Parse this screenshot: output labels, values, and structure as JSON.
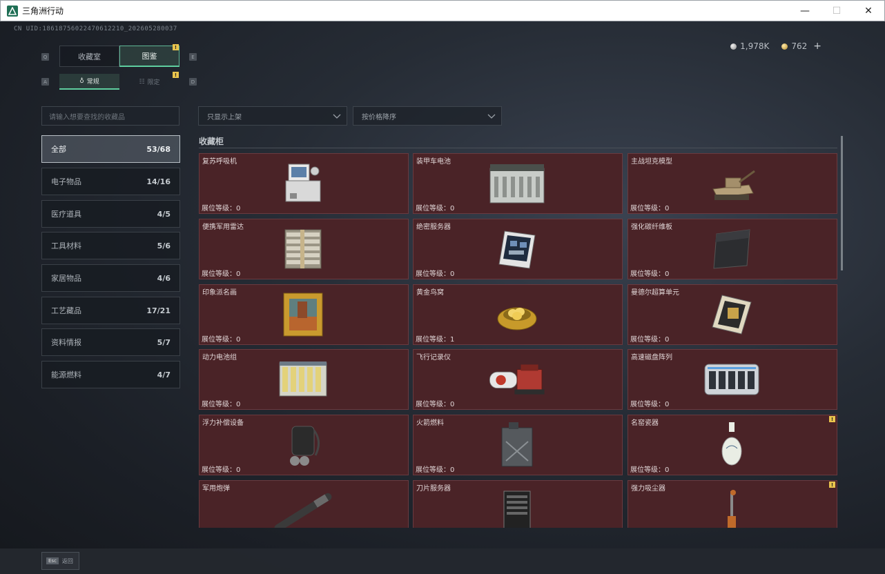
{
  "window": {
    "title": "三角洲行动",
    "minimize": "—",
    "maximize": "☐",
    "close": "✕"
  },
  "header": {
    "uid": "CN UID:18618756022470612210_202605280037"
  },
  "currency": [
    {
      "icon": "silver-coin-icon",
      "value": "1,978K"
    },
    {
      "icon": "gold-coin-icon",
      "value": "762"
    }
  ],
  "currency_add": "+",
  "keys": {
    "q": "Q",
    "e": "E",
    "a": "A",
    "d": "D"
  },
  "tabs": [
    {
      "label": "收藏室",
      "active": false
    },
    {
      "label": "图鉴",
      "active": true,
      "badge": "!"
    }
  ],
  "subtabs": [
    {
      "label": "常规",
      "active": true
    },
    {
      "label": "限定",
      "active": false,
      "badge": "!"
    }
  ],
  "search": {
    "placeholder": "请输入想要查找的收藏品"
  },
  "filters": [
    {
      "value": "只显示上架"
    },
    {
      "value": "按价格降序"
    }
  ],
  "categories": [
    {
      "label": "全部",
      "count": "53/68",
      "active": true
    },
    {
      "label": "电子物品",
      "count": "14/16"
    },
    {
      "label": "医疗道具",
      "count": "4/5"
    },
    {
      "label": "工具材料",
      "count": "5/6"
    },
    {
      "label": "家居物品",
      "count": "4/6"
    },
    {
      "label": "工艺藏品",
      "count": "17/21"
    },
    {
      "label": "资料情报",
      "count": "5/7"
    },
    {
      "label": "能源燃料",
      "count": "4/7"
    }
  ],
  "section_title": "收藏柜",
  "level_prefix": "展位等级：",
  "items": [
    {
      "name": "复苏呼吸机",
      "level": "0",
      "icon": "ventilator-icon"
    },
    {
      "name": "装甲车电池",
      "level": "0",
      "icon": "battery-icon"
    },
    {
      "name": "主战坦克模型",
      "level": "0",
      "icon": "tank-model-icon"
    },
    {
      "name": "便携军用雷达",
      "level": "0",
      "icon": "radar-icon"
    },
    {
      "name": "绝密服务器",
      "level": "0",
      "icon": "server-board-icon"
    },
    {
      "name": "强化碳纤维板",
      "level": "0",
      "icon": "carbon-plate-icon"
    },
    {
      "name": "印象派名画",
      "level": "0",
      "icon": "painting-icon"
    },
    {
      "name": "黄金鸟窝",
      "level": "1",
      "icon": "gold-nest-icon"
    },
    {
      "name": "曼德尔超算单元",
      "level": "0",
      "icon": "compute-unit-icon"
    },
    {
      "name": "动力电池组",
      "level": "0",
      "icon": "battery-pack-icon"
    },
    {
      "name": "飞行记录仪",
      "level": "0",
      "icon": "flight-recorder-icon"
    },
    {
      "name": "高速磁盘阵列",
      "level": "0",
      "icon": "disk-array-icon"
    },
    {
      "name": "浮力补偿设备",
      "level": "0",
      "icon": "buoyancy-device-icon"
    },
    {
      "name": "火箭燃料",
      "level": "0",
      "icon": "fuel-can-icon"
    },
    {
      "name": "名窑瓷器",
      "level": "0",
      "icon": "vase-icon",
      "badge": "!"
    },
    {
      "name": "军用炮弹",
      "level": "",
      "icon": "shell-icon"
    },
    {
      "name": "刀片服务器",
      "level": "",
      "icon": "blade-server-icon"
    },
    {
      "name": "强力吸尘器",
      "level": "",
      "icon": "vacuum-icon",
      "badge": "!"
    }
  ],
  "bottom": {
    "esc_key": "Esc",
    "esc_label": "返回"
  }
}
